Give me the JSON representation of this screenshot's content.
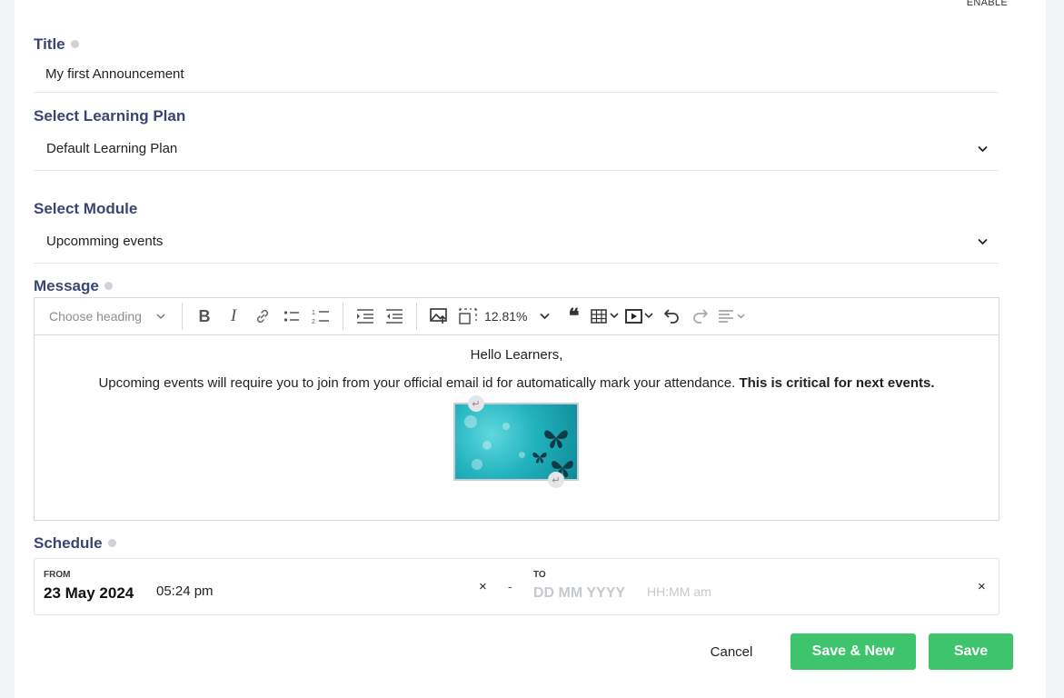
{
  "header": {
    "enable_label": "ENABLE"
  },
  "title_field": {
    "label": "Title",
    "value": "My first Announcement"
  },
  "learning_plan": {
    "label": "Select Learning Plan",
    "value": "Default Learning Plan"
  },
  "module": {
    "label": "Select Module",
    "value": "Upcomming events"
  },
  "message": {
    "label": "Message",
    "toolbar": {
      "heading_placeholder": "Choose heading",
      "zoom": "12.81%"
    },
    "body": {
      "line1": "Hello Learners,",
      "line2_regular": "Upcoming events will require you to join from your official email id for automatically mark your attendance. ",
      "line2_bold": "This is critical for next events."
    }
  },
  "schedule": {
    "label": "Schedule",
    "from_label": "FROM",
    "from_date": "23 May 2024",
    "from_time": "05:24 pm",
    "separator": "-",
    "to_label": "TO",
    "to_date_placeholder": "DD MM YYYY",
    "to_time_placeholder": "HH:MM am",
    "clear_glyph": "×"
  },
  "actions": {
    "cancel": "Cancel",
    "save_new": "Save & New",
    "save": "Save"
  },
  "colors": {
    "accent_green": "#3ec46d",
    "label_navy": "#3a4672"
  }
}
